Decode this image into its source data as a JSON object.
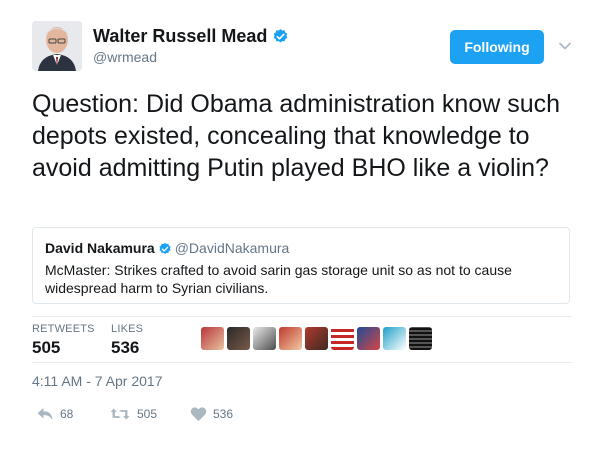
{
  "author": {
    "name": "Walter Russell Mead",
    "handle": "@wrmead",
    "verified": true,
    "avatar_icon": "author-avatar"
  },
  "follow_button": {
    "label": "Following",
    "color": "#1da1f2"
  },
  "tweet": {
    "text": "Question: Did Obama administration know such depots existed, concealing that knowledge to avoid admitting Putin played BHO like a violin?"
  },
  "quoted_tweet": {
    "author_name": "David Nakamura",
    "author_handle": "@DavidNakamura",
    "verified": true,
    "text": "McMaster: Strikes crafted to avoid sarin gas storage unit so as not to cause widespread harm to Syrian civilians."
  },
  "stats": {
    "retweets_label": "RETWEETS",
    "retweets_value": "505",
    "likes_label": "LIKES",
    "likes_value": "536",
    "liker_avatar_count": 9
  },
  "timestamp": "4:11 AM - 7 Apr 2017",
  "actions": {
    "reply_count": "68",
    "retweet_count": "505",
    "like_count": "536"
  },
  "colors": {
    "accent": "#1da1f2",
    "secondary_text": "#657786",
    "border": "#e1e8ed",
    "icon": "#aab8c2"
  }
}
